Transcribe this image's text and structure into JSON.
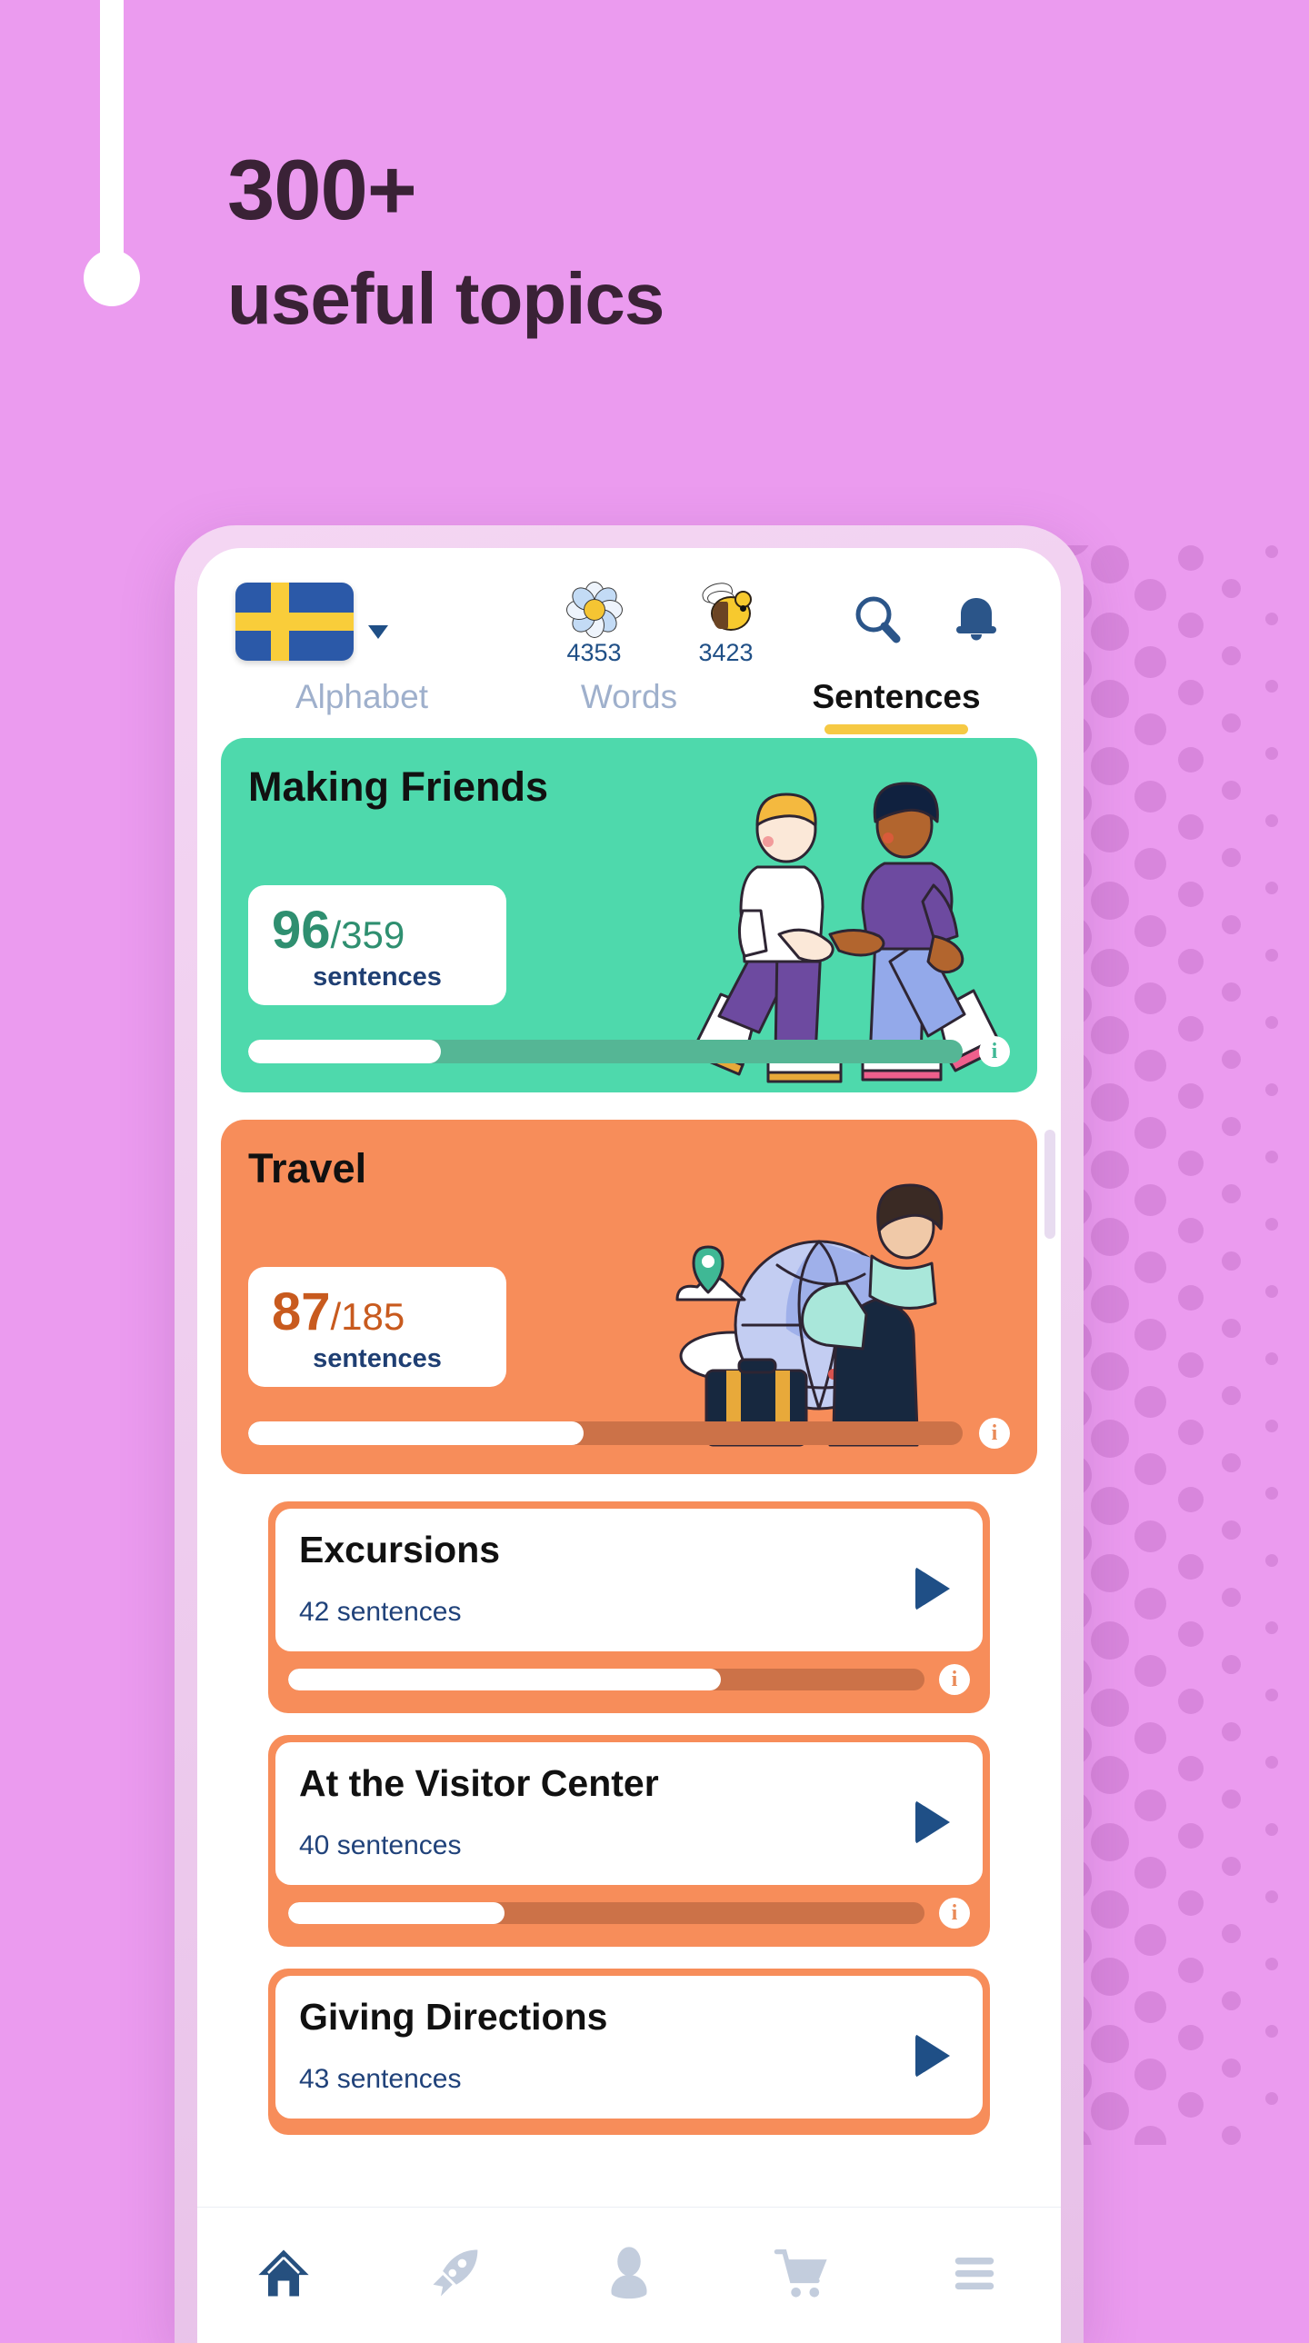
{
  "promo": {
    "line1": "300+",
    "line2": "useful topics",
    "bg_color": "#eb9bef",
    "text_color": "#3a2236"
  },
  "app": {
    "language": {
      "name": "Swedish",
      "flag_icon": "swedish-flag",
      "dropdown_icon": "caret-down-icon"
    },
    "stats": [
      {
        "icon": "flower-icon",
        "value": "4353"
      },
      {
        "icon": "bee-icon",
        "value": "3423"
      }
    ],
    "actions": [
      {
        "icon": "search-icon",
        "label": "Search"
      },
      {
        "icon": "bell-icon",
        "label": "Notifications"
      }
    ],
    "tabs": [
      {
        "label": "Alphabet",
        "active": false
      },
      {
        "label": "Words",
        "active": false
      },
      {
        "label": "Sentences",
        "active": true
      }
    ],
    "accent_underline_color": "#f6c944",
    "topic_cards": [
      {
        "title": "Making Friends",
        "completed": "96",
        "total": "/359",
        "unit": "sentences",
        "progress_percent": 27,
        "color": "#4ed9ac",
        "illustration": "two-people-shaking-hands",
        "info_icon": "info-icon"
      },
      {
        "title": "Travel",
        "completed": "87",
        "total": "/185",
        "unit": "sentences",
        "progress_percent": 47,
        "color": "#f78d5a",
        "illustration": "woman-with-globe-and-suitcase",
        "info_icon": "info-icon"
      }
    ],
    "sub_topics": [
      {
        "title": "Excursions",
        "count": "42 sentences",
        "progress_percent": 68,
        "play_icon": "play-icon",
        "info_icon": "info-icon"
      },
      {
        "title": "At the Visitor Center",
        "count": "40 sentences",
        "progress_percent": 34,
        "play_icon": "play-icon",
        "info_icon": "info-icon"
      },
      {
        "title": "Giving Directions",
        "count": "43 sentences",
        "progress_percent": 0,
        "play_icon": "play-icon",
        "info_icon": "info-icon"
      }
    ],
    "bottom_nav": [
      {
        "icon": "home-icon",
        "active": true
      },
      {
        "icon": "rocket-icon",
        "active": false
      },
      {
        "icon": "person-icon",
        "active": false
      },
      {
        "icon": "cart-icon",
        "active": false
      },
      {
        "icon": "menu-icon",
        "active": false
      }
    ]
  }
}
